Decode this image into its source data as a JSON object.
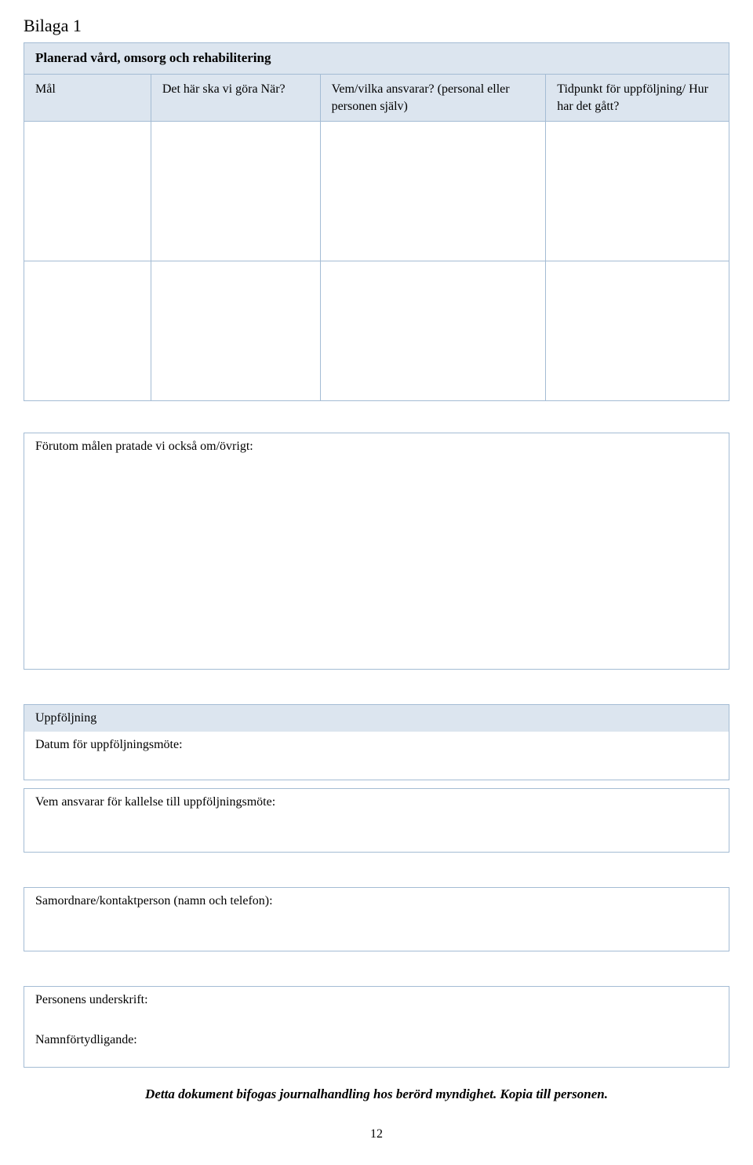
{
  "appendix_label": "Bilaga 1",
  "plan_table": {
    "title": "Planerad vård, omsorg och rehabilitering",
    "headers": {
      "col1": "Mål",
      "col2": "Det här ska vi göra När?",
      "col3": "Vem/vilka ansvarar? (personal eller personen själv)",
      "col4": "Tidpunkt för uppföljning/ Hur har det gått?"
    }
  },
  "notes": {
    "label": "Förutom målen pratade vi också om/övrigt:"
  },
  "followup": {
    "header": "Uppföljning",
    "date_label": "Datum för uppföljningsmöte:",
    "responsible_label": "Vem ansvarar för kallelse till uppföljningsmöte:"
  },
  "coordinator": {
    "label": "Samordnare/kontaktperson (namn och telefon):"
  },
  "signature": {
    "label": "Personens underskrift:"
  },
  "clarification": {
    "label": "Namnförtydligande:"
  },
  "footer_note": "Detta dokument bifogas journalhandling hos berörd myndighet. Kopia till personen.",
  "page_number": "12"
}
